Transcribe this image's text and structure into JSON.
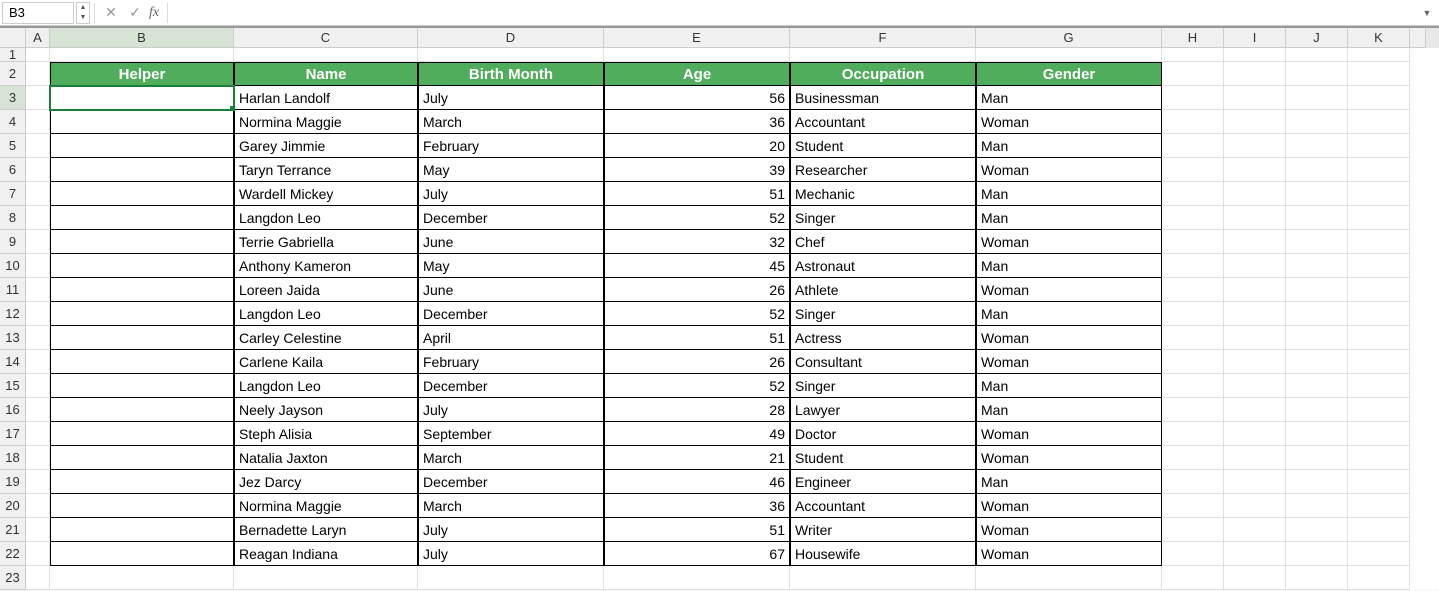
{
  "nameBox": "B3",
  "formula": "",
  "columns": [
    "A",
    "B",
    "C",
    "D",
    "E",
    "F",
    "G",
    "H",
    "I",
    "J",
    "K"
  ],
  "activeCell": {
    "row": 3,
    "col": "B"
  },
  "headers": [
    "Helper",
    "Name",
    "Birth Month",
    "Age",
    "Occupation",
    "Gender"
  ],
  "rows": [
    {
      "helper": "",
      "name": "Harlan Landolf",
      "month": "July",
      "age": 56,
      "occ": "Businessman",
      "gender": "Man"
    },
    {
      "helper": "",
      "name": "Normina Maggie",
      "month": "March",
      "age": 36,
      "occ": "Accountant",
      "gender": "Woman"
    },
    {
      "helper": "",
      "name": "Garey Jimmie",
      "month": "February",
      "age": 20,
      "occ": "Student",
      "gender": "Man"
    },
    {
      "helper": "",
      "name": "Taryn Terrance",
      "month": "May",
      "age": 39,
      "occ": "Researcher",
      "gender": "Woman"
    },
    {
      "helper": "",
      "name": "Wardell Mickey",
      "month": "July",
      "age": 51,
      "occ": "Mechanic",
      "gender": "Man"
    },
    {
      "helper": "",
      "name": "Langdon Leo",
      "month": "December",
      "age": 52,
      "occ": "Singer",
      "gender": "Man"
    },
    {
      "helper": "",
      "name": "Terrie Gabriella",
      "month": "June",
      "age": 32,
      "occ": "Chef",
      "gender": "Woman"
    },
    {
      "helper": "",
      "name": "Anthony Kameron",
      "month": "May",
      "age": 45,
      "occ": "Astronaut",
      "gender": "Man"
    },
    {
      "helper": "",
      "name": "Loreen Jaida",
      "month": "June",
      "age": 26,
      "occ": "Athlete",
      "gender": "Woman"
    },
    {
      "helper": "",
      "name": "Langdon Leo",
      "month": "December",
      "age": 52,
      "occ": "Singer",
      "gender": "Man"
    },
    {
      "helper": "",
      "name": "Carley Celestine",
      "month": "April",
      "age": 51,
      "occ": "Actress",
      "gender": "Woman"
    },
    {
      "helper": "",
      "name": "Carlene Kaila",
      "month": "February",
      "age": 26,
      "occ": "Consultant",
      "gender": "Woman"
    },
    {
      "helper": "",
      "name": "Langdon Leo",
      "month": "December",
      "age": 52,
      "occ": "Singer",
      "gender": "Man"
    },
    {
      "helper": "",
      "name": "Neely Jayson",
      "month": "July",
      "age": 28,
      "occ": "Lawyer",
      "gender": "Man"
    },
    {
      "helper": "",
      "name": "Steph Alisia",
      "month": "September",
      "age": 49,
      "occ": "Doctor",
      "gender": "Woman"
    },
    {
      "helper": "",
      "name": "Natalia Jaxton",
      "month": "March",
      "age": 21,
      "occ": "Student",
      "gender": "Woman"
    },
    {
      "helper": "",
      "name": "Jez Darcy",
      "month": "December",
      "age": 46,
      "occ": "Engineer",
      "gender": "Man"
    },
    {
      "helper": "",
      "name": "Normina Maggie",
      "month": "March",
      "age": 36,
      "occ": "Accountant",
      "gender": "Woman"
    },
    {
      "helper": "",
      "name": "Bernadette Laryn",
      "month": "July",
      "age": 51,
      "occ": "Writer",
      "gender": "Woman"
    },
    {
      "helper": "",
      "name": "Reagan Indiana",
      "month": "July",
      "age": 67,
      "occ": "Housewife",
      "gender": "Woman"
    }
  ],
  "fxLabel": "fx"
}
